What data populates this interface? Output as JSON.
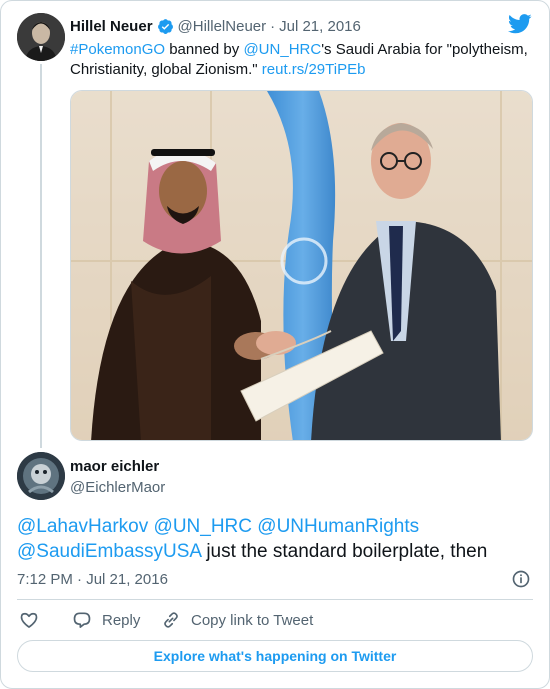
{
  "tweet": {
    "author_name": "Hillel Neuer",
    "author_handle": "@HillelNeuer",
    "separator": "·",
    "date": "Jul 21, 2016",
    "text_parts": [
      {
        "text": "#PokemonGO",
        "kind": "link"
      },
      {
        "text": " banned by ",
        "kind": "plain"
      },
      {
        "text": "@UN_HRC",
        "kind": "link"
      },
      {
        "text": "'s Saudi Arabia for \"polytheism, Christianity, global Zionism.\" ",
        "kind": "plain"
      },
      {
        "text": "reut.rs/29TiPEb",
        "kind": "link"
      }
    ],
    "verified_icon": "verified-badge-icon"
  },
  "reply": {
    "author_name": "maor eichler",
    "author_handle": "@EichlerMaor",
    "text_parts": [
      {
        "text": "@LahavHarkov",
        "kind": "link"
      },
      {
        "text": " ",
        "kind": "plain"
      },
      {
        "text": "@UN_HRC",
        "kind": "link"
      },
      {
        "text": " ",
        "kind": "plain"
      },
      {
        "text": "@UNHumanRights",
        "kind": "link"
      },
      {
        "text": " ",
        "kind": "plain"
      },
      {
        "text": "@SaudiEmbassyUSA",
        "kind": "link"
      },
      {
        "text": " just the standard boilerplate, then",
        "kind": "plain"
      }
    ],
    "timestamp": "7:12 PM · Jul 21, 2016"
  },
  "actions": {
    "like_icon": "heart-icon",
    "reply_label": "Reply",
    "copy_label": "Copy link to Tweet"
  },
  "explore_label": "Explore what's happening on Twitter",
  "colors": {
    "link": "#1d9bf0",
    "text": "#0f1419",
    "muted": "#536471",
    "border": "#cfd9de"
  }
}
